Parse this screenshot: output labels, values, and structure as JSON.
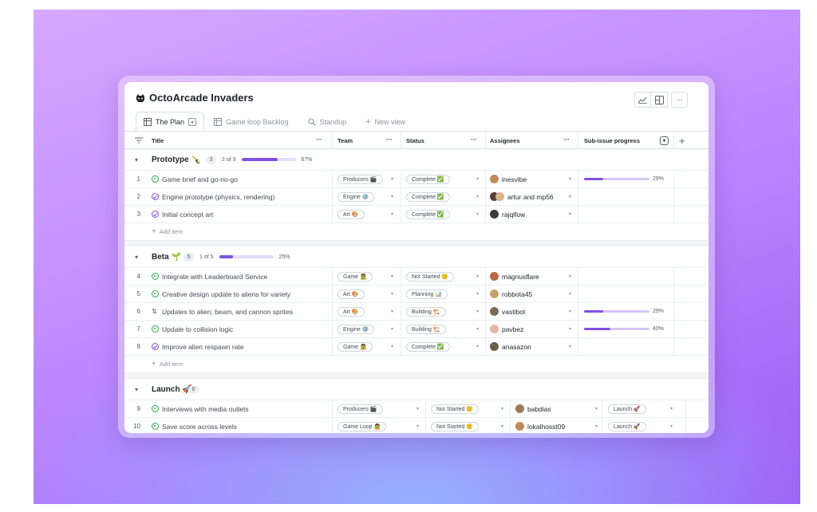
{
  "app": {
    "title": "OctoArcade Invaders"
  },
  "tabs": [
    {
      "label": "The Plan",
      "icon": "table-icon",
      "active": true
    },
    {
      "label": "Game loop Backlog",
      "icon": "table-icon",
      "active": false
    },
    {
      "label": "Standup",
      "icon": "search-icon",
      "active": false
    },
    {
      "label": "New view",
      "icon": "plus-icon",
      "active": false
    }
  ],
  "columns": {
    "title": "Title",
    "team": "Team",
    "status": "Status",
    "assignees": "Assignees",
    "progress": "Sub-issue progress"
  },
  "add_item_label": "Add item",
  "colors": {
    "accent": "#8250df",
    "open": "#2da44e",
    "closed": "#8250df"
  },
  "groups": [
    {
      "name": "Prototype 🍾",
      "count": "3",
      "progress_text": "2 of 3",
      "progress_fraction": 0.67,
      "progress_pct": "67%",
      "rows": [
        {
          "num": "1",
          "state": "open",
          "title": "Game brief and go-no-go",
          "team": "Producers 🎬",
          "status": "Complete ✅",
          "assignees": "inesvibe",
          "avatars": 1,
          "progress": 0.29,
          "progress_label": "29%"
        },
        {
          "num": "2",
          "state": "done",
          "title": "Engine prototype (physics, rendering)",
          "team": "Engine ⚙️",
          "status": "Complete ✅",
          "assignees": "artur and mp56",
          "avatars": 2,
          "progress": null,
          "progress_label": ""
        },
        {
          "num": "3",
          "state": "done",
          "title": "Initial concept art",
          "team": "Art 🎨",
          "status": "Complete ✅",
          "assignees": "rajqlfow",
          "avatars": 1,
          "progress": null,
          "progress_label": ""
        }
      ]
    },
    {
      "name": "Beta 🌱",
      "count": "5",
      "progress_text": "1 of 5",
      "progress_fraction": 0.25,
      "progress_pct": "25%",
      "rows": [
        {
          "num": "4",
          "state": "open",
          "title": "Integrate with Leaderboard Service",
          "team": "Game 🧟",
          "status": "Not Started 🙂",
          "assignees": "magnusflare",
          "avatars": 1,
          "progress": null,
          "progress_label": ""
        },
        {
          "num": "5",
          "state": "open",
          "title": "Creative design update to aliens for variety",
          "team": "Art 🎨",
          "status": "Planning 📊",
          "assignees": "robbota45",
          "avatars": 1,
          "progress": null,
          "progress_label": ""
        },
        {
          "num": "6",
          "state": "pr",
          "title": "Updates to alien, beam, and cannon sprites",
          "team": "Art 🎨",
          "status": "Building 🏗️",
          "assignees": "vastibot",
          "avatars": 1,
          "progress": 0.29,
          "progress_label": "29%"
        },
        {
          "num": "7",
          "state": "open",
          "title": "Update to collision logic",
          "team": "Engine ⚙️",
          "status": "Building 🏗️",
          "assignees": "pavbez",
          "avatars": 1,
          "progress": 0.4,
          "progress_label": "40%"
        },
        {
          "num": "8",
          "state": "done",
          "title": "Improve alien respawn rate",
          "team": "Game 🧟",
          "status": "Complete ✅",
          "assignees": "anasazon",
          "avatars": 1,
          "progress": null,
          "progress_label": ""
        }
      ]
    },
    {
      "name": "Launch 🚀",
      "count": "6",
      "rows": [
        {
          "num": "9",
          "state": "open",
          "title": "Interviews with media outlets",
          "team": "Producers 🎬",
          "status": "Not Started 🙂",
          "assignees": "babdias",
          "avatars": 1,
          "milestone": "Launch 🚀"
        },
        {
          "num": "10",
          "state": "open",
          "title": "Save score across levels",
          "team": "Game Loop 🧟",
          "status": "Not Started 🙂",
          "assignees": "lokalhosst09",
          "avatars": 1,
          "milestone": "Launch 🚀"
        }
      ]
    }
  ]
}
